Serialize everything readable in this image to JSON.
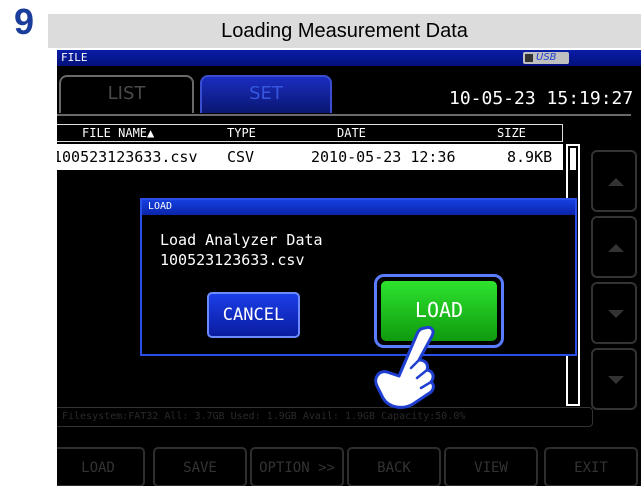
{
  "step_number": "9",
  "step_title": "Loading Measurement Data",
  "screen": {
    "topbar_label": "FILE",
    "usb_label": "USB",
    "tabs": [
      {
        "label": "LIST"
      },
      {
        "label": "SET"
      }
    ],
    "datetime": "10-05-23 15:19:27",
    "columns": [
      "FILE NAME▲",
      "TYPE",
      "DATE",
      "SIZE"
    ],
    "rows": [
      {
        "name": "100523123633.csv",
        "type": "CSV",
        "date": "2010-05-23 12:36",
        "size": "8.9KB"
      }
    ],
    "status_line": "Filesystem:FAT32 All: 3.7GB Used: 1.9GB Avail: 1.9GB Capacity:50.0%",
    "bottom_buttons": [
      "LOAD",
      "SAVE",
      "OPTION >>",
      "BACK",
      "VIEW",
      "EXIT"
    ]
  },
  "dialog": {
    "title": "LOAD",
    "message_line1": "Load Analyzer Data",
    "message_line2": "100523123633.csv",
    "cancel_label": "CANCEL",
    "load_label": "LOAD"
  },
  "colors": {
    "accent_blue": "#0a1ea8",
    "load_green": "#18c418",
    "step_number": "#1a3c9a"
  }
}
